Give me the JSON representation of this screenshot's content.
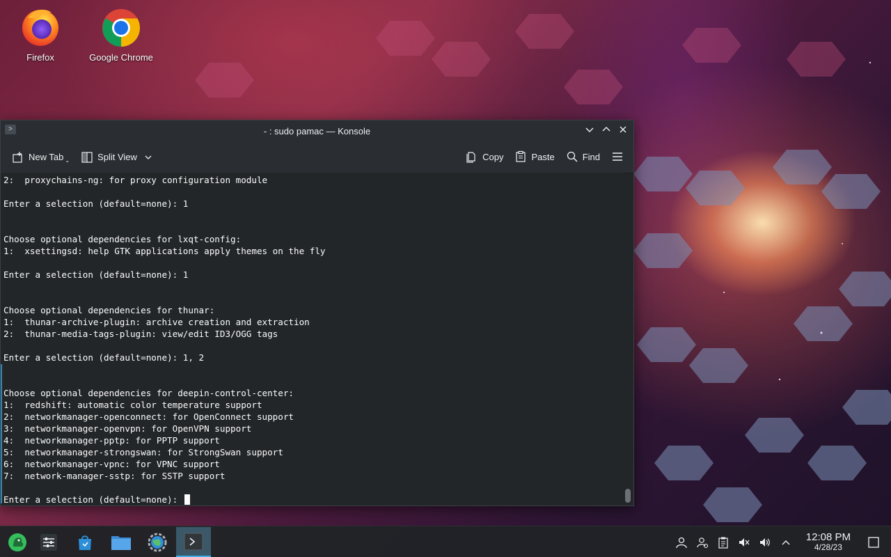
{
  "desktop": {
    "icons": [
      {
        "label": "Firefox"
      },
      {
        "label": "Google Chrome"
      }
    ]
  },
  "window": {
    "title": "- : sudo pamac — Konsole",
    "toolbar": {
      "new_tab": "New Tab",
      "split_view": "Split View",
      "copy": "Copy",
      "paste": "Paste",
      "find": "Find"
    },
    "terminal_lines": [
      "2:  proxychains-ng: for proxy configuration module",
      "",
      "Enter a selection (default=none): 1",
      "",
      "",
      "Choose optional dependencies for lxqt-config:",
      "1:  xsettingsd: help GTK applications apply themes on the fly",
      "",
      "Enter a selection (default=none): 1",
      "",
      "",
      "Choose optional dependencies for thunar:",
      "1:  thunar-archive-plugin: archive creation and extraction",
      "2:  thunar-media-tags-plugin: view/edit ID3/OGG tags",
      "",
      "Enter a selection (default=none): 1, 2",
      "",
      "",
      "Choose optional dependencies for deepin-control-center:",
      "1:  redshift: automatic color temperature support",
      "2:  networkmanager-openconnect: for OpenConnect support",
      "3:  networkmanager-openvpn: for OpenVPN support",
      "4:  networkmanager-pptp: for PPTP support",
      "5:  networkmanager-strongswan: for StrongSwan support",
      "6:  networkmanager-vpnc: for VPNC support",
      "7:  network-manager-sstp: for SSTP support",
      ""
    ],
    "prompt": "Enter a selection (default=none): "
  },
  "taskbar": {
    "clock": {
      "time": "12:08 PM",
      "date": "4/28/23"
    }
  },
  "colors": {
    "accent": "#3daee9",
    "terminal_bg": "#232629",
    "terminal_fg": "#fcfcfc"
  }
}
